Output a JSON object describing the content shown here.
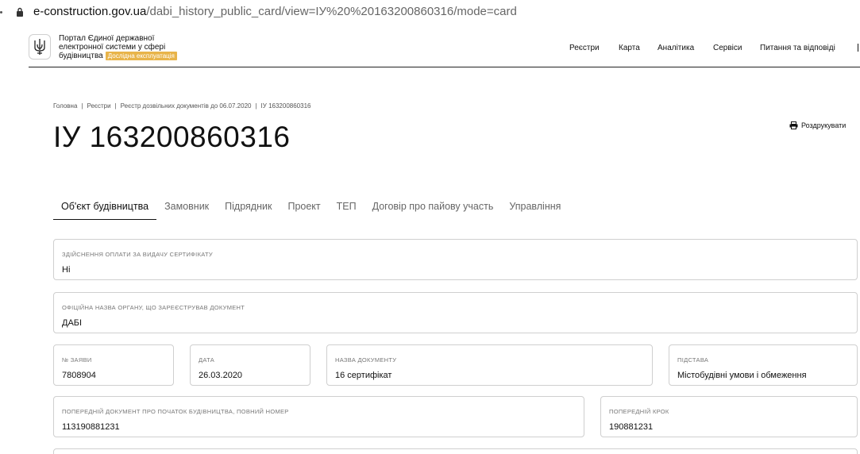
{
  "browser": {
    "url_domain": "e-construction.gov.ua",
    "url_path": "/dabi_history_public_card/view=ІУ%20%20163200860316/mode=card"
  },
  "header": {
    "portal_line1": "Портал Єдиної державної",
    "portal_line2": "електронної системи у сфері",
    "portal_line3": "будівництва",
    "badge": "Дослідна експлуатація",
    "nav": [
      "Реєстри",
      "Карта",
      "Аналітика",
      "Сервіси",
      "Питання та відповіді"
    ]
  },
  "breadcrumb": [
    "Головна",
    "Реєстри",
    "Реєстр дозвільних документів до 06.07.2020",
    "ІУ 163200860316"
  ],
  "page_title": "ІУ 163200860316",
  "print_label": "Роздрукувати",
  "tabs": [
    "Об'єкт будівництва",
    "Замовник",
    "Підрядник",
    "Проект",
    "ТЕП",
    "Договір про пайову участь",
    "Управління"
  ],
  "active_tab": 0,
  "fields": {
    "payment": {
      "label": "Здійснення оплати за видачу сертифікату",
      "value": "Ні"
    },
    "authority": {
      "label": "Офіційна назва органу, що зареєстрував документ",
      "value": "ДАБІ"
    },
    "app_number": {
      "label": "№ заяви",
      "value": "7808904"
    },
    "date": {
      "label": "Дата",
      "value": "26.03.2020"
    },
    "doc_name": {
      "label": "Назва документу",
      "value": "16 сертифікат"
    },
    "basis": {
      "label": "Підстава",
      "value": "Містобудівні умови і обмеження"
    },
    "prev_doc": {
      "label": "Попередній документ про початок будівництва, повний номер",
      "value": "113190881231"
    },
    "prev_step": {
      "label": "Попередній крок",
      "value": "190881231"
    }
  }
}
